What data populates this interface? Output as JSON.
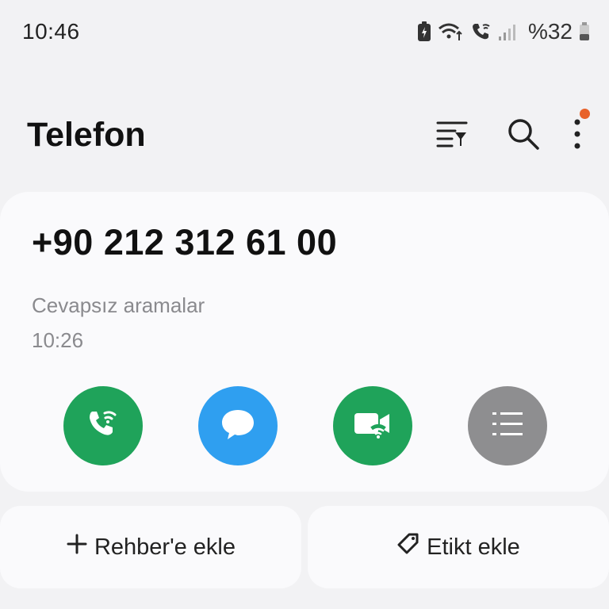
{
  "status_bar": {
    "time": "10:46",
    "battery": "%32"
  },
  "header": {
    "title": "Telefon",
    "icons": [
      "filter-icon",
      "search-icon",
      "more-vertical-icon"
    ],
    "notification_dot_color": "#e8622a"
  },
  "call_log": {
    "number": "+90 212 312 61 00",
    "type": "Cevapsız aramalar",
    "time": "10:26"
  },
  "actions": [
    {
      "icon": "wifi-call-icon",
      "color": "#1fa35a"
    },
    {
      "icon": "message-icon",
      "color": "#2f9ff0"
    },
    {
      "icon": "wifi-video-call-icon",
      "color": "#1fa35a"
    },
    {
      "icon": "details-list-icon",
      "color": "#8e8e90"
    }
  ],
  "bottom": {
    "add_contact_label": "Rehber'e ekle",
    "add_tag_label": "Etikt ekle"
  }
}
